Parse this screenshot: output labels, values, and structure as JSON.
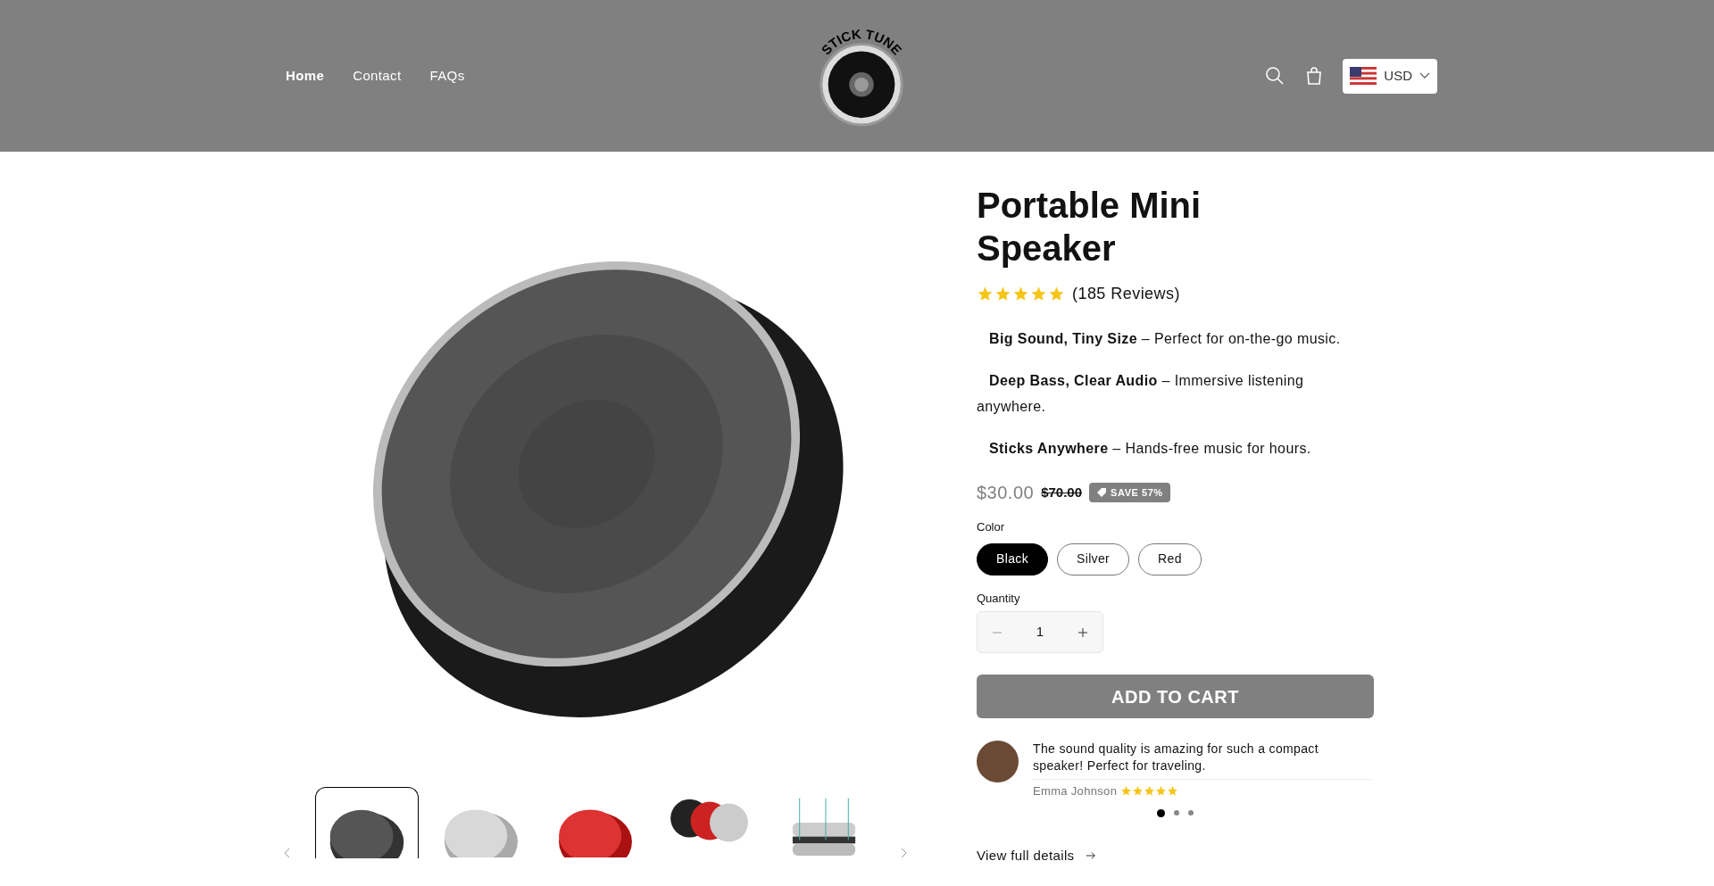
{
  "header": {
    "nav": [
      {
        "label": "Home",
        "selected": true
      },
      {
        "label": "Contact",
        "selected": false
      },
      {
        "label": "FAQs",
        "selected": false
      }
    ],
    "logo": {
      "text": "STICK TUNE"
    },
    "currency": {
      "label": "USD"
    }
  },
  "gallery": {
    "thumbnails": [
      {
        "kind": "black",
        "selected": true
      },
      {
        "kind": "silver",
        "selected": false
      },
      {
        "kind": "red",
        "selected": false
      },
      {
        "kind": "trio",
        "selected": false
      },
      {
        "kind": "diagram",
        "selected": false
      }
    ]
  },
  "product": {
    "title": "Portable Mini Speaker",
    "stars": 5,
    "reviews": "(185 Reviews)",
    "features": [
      "**Big Sound, Tiny Size** – Perfect for on-the-go music.",
      "**Deep Bass, Clear Audio** – Immersive listening anywhere.",
      "**Sticks Anywhere** – Hands-free music for hours."
    ],
    "price": "$30.00",
    "compare_price": "$70.00",
    "badge": "SAVE 57%",
    "color_label": "Color",
    "colors": [
      {
        "label": "Black",
        "selected": true
      },
      {
        "label": "Silver",
        "selected": false
      },
      {
        "label": "Red",
        "selected": false
      }
    ],
    "quantity_label": "Quantity",
    "quantity": "1",
    "add_to_cart": "ADD TO CART",
    "review": {
      "text": "The sound quality is amazing for such a compact speaker! Perfect for traveling.",
      "author": "Emma Johnson",
      "stars": 5
    },
    "review_dots": [
      {
        "selected": true
      },
      {
        "selected": false
      },
      {
        "selected": false
      }
    ],
    "details_link": "View full details"
  }
}
